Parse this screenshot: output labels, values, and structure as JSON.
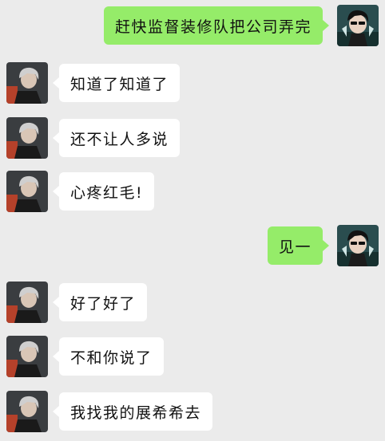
{
  "colors": {
    "background": "#ebebeb",
    "outgoing_bubble": "#95ec69",
    "incoming_bubble": "#ffffff"
  },
  "messages": [
    {
      "direction": "out",
      "text": "赶快监督装修队把公司弄完",
      "avatar": "self-avatar"
    },
    {
      "direction": "in",
      "text": "知道了知道了",
      "avatar": "contact-avatar"
    },
    {
      "direction": "in",
      "text": "还不让人多说",
      "avatar": "contact-avatar"
    },
    {
      "direction": "in",
      "text": "心疼红毛!",
      "avatar": "contact-avatar"
    },
    {
      "direction": "out",
      "text": "见一",
      "avatar": "self-avatar"
    },
    {
      "direction": "in",
      "text": "好了好了",
      "avatar": "contact-avatar"
    },
    {
      "direction": "in",
      "text": "不和你说了",
      "avatar": "contact-avatar"
    },
    {
      "direction": "in",
      "text": "我找我的展希希去",
      "avatar": "contact-avatar"
    }
  ]
}
